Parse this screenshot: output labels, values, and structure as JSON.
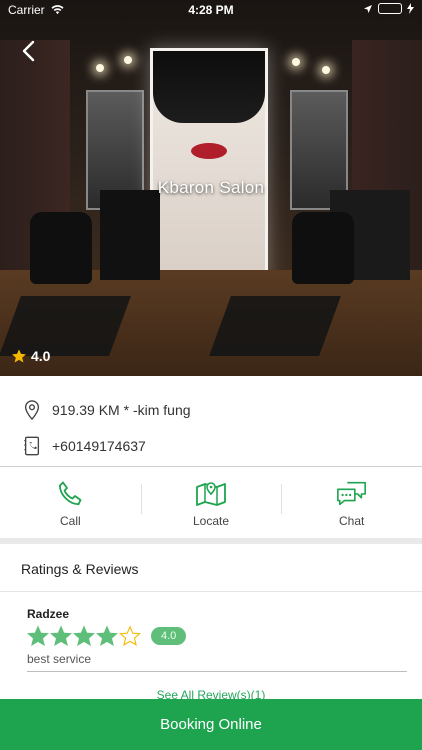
{
  "status_bar": {
    "carrier": "Carrier",
    "time": "4:28 PM"
  },
  "salon": {
    "name": "Kbaron Salon",
    "rating": "4.0"
  },
  "info": {
    "address": "919.39 KM * -kim fung",
    "phone": "+60149174637"
  },
  "actions": [
    {
      "label": "Call",
      "icon": "phone-icon"
    },
    {
      "label": "Locate",
      "icon": "map-icon"
    },
    {
      "label": "Chat",
      "icon": "chat-icon"
    }
  ],
  "reviews": {
    "title": "Ratings & Reviews",
    "items": [
      {
        "name": "Radzee",
        "stars": 4,
        "max_stars": 5,
        "score": "4.0",
        "comment": "best service"
      }
    ],
    "see_all": "See All Review(s)(1)"
  },
  "booking_label": "Booking Online",
  "colors": {
    "accent": "#1ea44f",
    "badge": "#5fbf7a",
    "star": "#f5b800"
  }
}
